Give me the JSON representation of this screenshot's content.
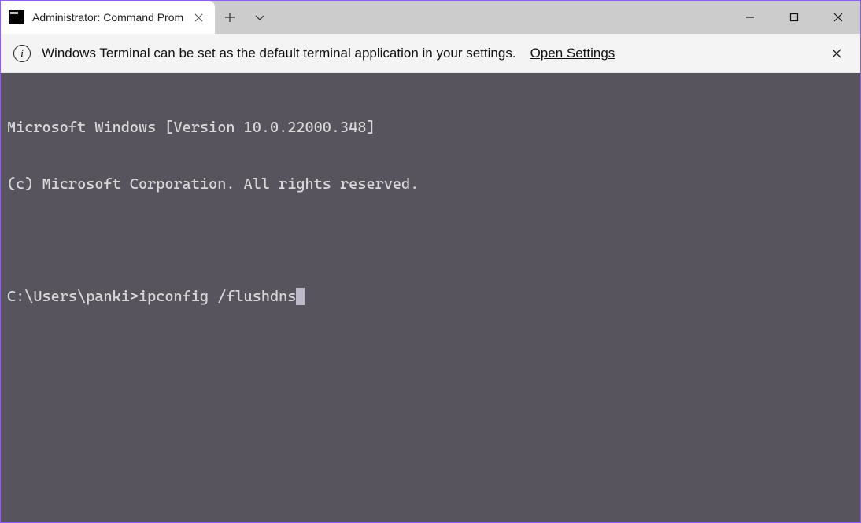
{
  "tab": {
    "title": "Administrator: Command Prom"
  },
  "infobar": {
    "message": "Windows Terminal can be set as the default terminal application in your settings.",
    "link_label": "Open Settings"
  },
  "terminal": {
    "line1": "Microsoft Windows [Version 10.0.22000.348]",
    "line2": "(c) Microsoft Corporation. All rights reserved.",
    "prompt": "C:\\Users\\panki>",
    "command": "ipconfig /flushdns"
  }
}
